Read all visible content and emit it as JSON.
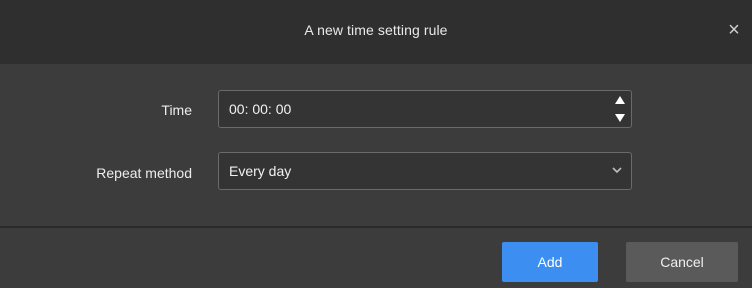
{
  "dialog": {
    "title": "A new time setting rule",
    "close_icon": "close-icon"
  },
  "form": {
    "time_label": "Time",
    "time_value": "00: 00: 00",
    "repeat_label": "Repeat method",
    "repeat_value": "Every day"
  },
  "actions": {
    "add_label": "Add",
    "cancel_label": "Cancel"
  },
  "colors": {
    "titlebar": "#2f2f2f",
    "body": "#3c3c3c",
    "primary": "#3c8ff0",
    "secondary": "#5a5a5a"
  }
}
